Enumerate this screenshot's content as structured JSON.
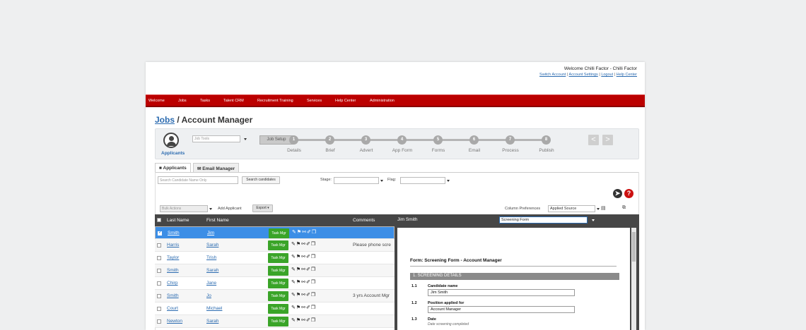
{
  "header": {
    "welcome": "Welcome Chilli Factor - Chilli Factor",
    "links": [
      "Switch Account",
      "Account Settings",
      "Logout",
      "Help Center"
    ]
  },
  "nav": [
    "Welcome",
    "Jobs",
    "Tasks",
    "Talent CRM",
    "Recruitment Training",
    "Services",
    "Help Center",
    "Administration"
  ],
  "page": {
    "crumb": "Jobs",
    "separator": " / ",
    "title": "Account Manager"
  },
  "steps": {
    "section_label": "Applicants",
    "job_tools_placeholder": "Job Tools",
    "job_setup": "Job Setup",
    "items": [
      {
        "num": "1",
        "label": "Details"
      },
      {
        "num": "2",
        "label": "Brief"
      },
      {
        "num": "3",
        "label": "Advert"
      },
      {
        "num": "4",
        "label": "App Form"
      },
      {
        "num": "5",
        "label": "Forms"
      },
      {
        "num": "6",
        "label": "Email"
      },
      {
        "num": "7",
        "label": "Process"
      },
      {
        "num": "8",
        "label": "Publish"
      }
    ],
    "prev_glyph": "<",
    "next_glyph": ">"
  },
  "tabs": {
    "applicants": "Applicants",
    "email_manager": "Email Manager"
  },
  "search": {
    "placeholder": "Search Candidate Name Only",
    "button": "Search candidates",
    "stage_label": "Stage:",
    "flag_label": "Flag:",
    "help_glyph": "?"
  },
  "toolbar": {
    "bulk_actions": "Bulk Actions",
    "add_applicant": "Add Applicant",
    "export": "Export",
    "column_prefs_label": "Column Preferences",
    "column_prefs_value": "Applied Source"
  },
  "grid": {
    "columns": {
      "last": "Last Name",
      "first": "First Name",
      "comments": "Comments"
    },
    "task_label": "Task Mgr",
    "rows": [
      {
        "last": "Smith",
        "first": "Jim",
        "comment": "",
        "checked": true,
        "selected": true
      },
      {
        "last": "Harris",
        "first": "Sarah",
        "comment": "Please phone scre",
        "checked": false,
        "selected": false
      },
      {
        "last": "Taylor",
        "first": "Trish",
        "comment": "",
        "checked": false,
        "selected": false
      },
      {
        "last": "Smith",
        "first": "Sarah",
        "comment": "",
        "checked": false,
        "selected": false
      },
      {
        "last": "Chirp",
        "first": "Jane",
        "comment": "",
        "checked": false,
        "selected": false
      },
      {
        "last": "Smith",
        "first": "Jo",
        "comment": "3 yrs Account Mgr",
        "checked": false,
        "selected": false
      },
      {
        "last": "Court",
        "first": "Michael",
        "comment": "",
        "checked": false,
        "selected": false
      },
      {
        "last": "Newton",
        "first": "Sarah",
        "comment": "",
        "checked": false,
        "selected": false
      }
    ]
  },
  "detail": {
    "name": "Jim Smith",
    "form_select": "Screening Form",
    "form_title": "Form: Screening Form - Account Manager",
    "section": "1.  SCREENING DETAILS",
    "fields": [
      {
        "num": "1.1",
        "label": "Candidate name",
        "value": "Jim Smith"
      },
      {
        "num": "1.2",
        "label": "Position applied for",
        "value": "Account Manager"
      },
      {
        "num": "1.3",
        "label": "Date",
        "hint": "Date screening completed"
      }
    ]
  },
  "colors": {
    "nav_red": "#bb0000",
    "task_green": "#3aa428",
    "selected_blue": "#3c8ee6",
    "link_blue": "#2b6bb0"
  }
}
